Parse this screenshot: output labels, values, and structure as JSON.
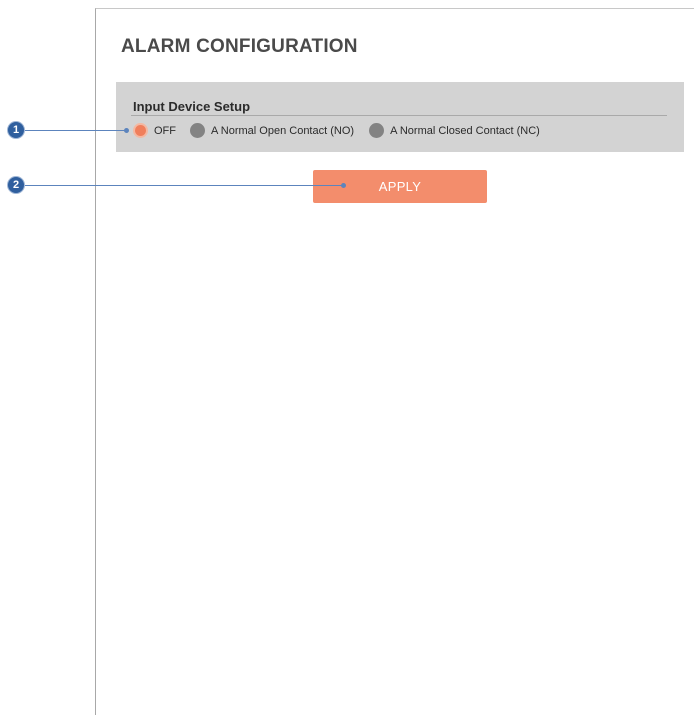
{
  "page": {
    "title": "ALARM CONFIGURATION"
  },
  "input_device_setup": {
    "heading": "Input Device Setup",
    "options": [
      {
        "label": "OFF",
        "selected": true
      },
      {
        "label": "A Normal Open Contact (NO)",
        "selected": false
      },
      {
        "label": "A Normal Closed Contact (NC)",
        "selected": false
      }
    ]
  },
  "apply_label": "APPLY",
  "callouts": [
    {
      "number": "1"
    },
    {
      "number": "2"
    }
  ],
  "colors": {
    "accent": "#f38d6c",
    "panel": "#d3d3d3",
    "callout": "#2f5f9e"
  }
}
